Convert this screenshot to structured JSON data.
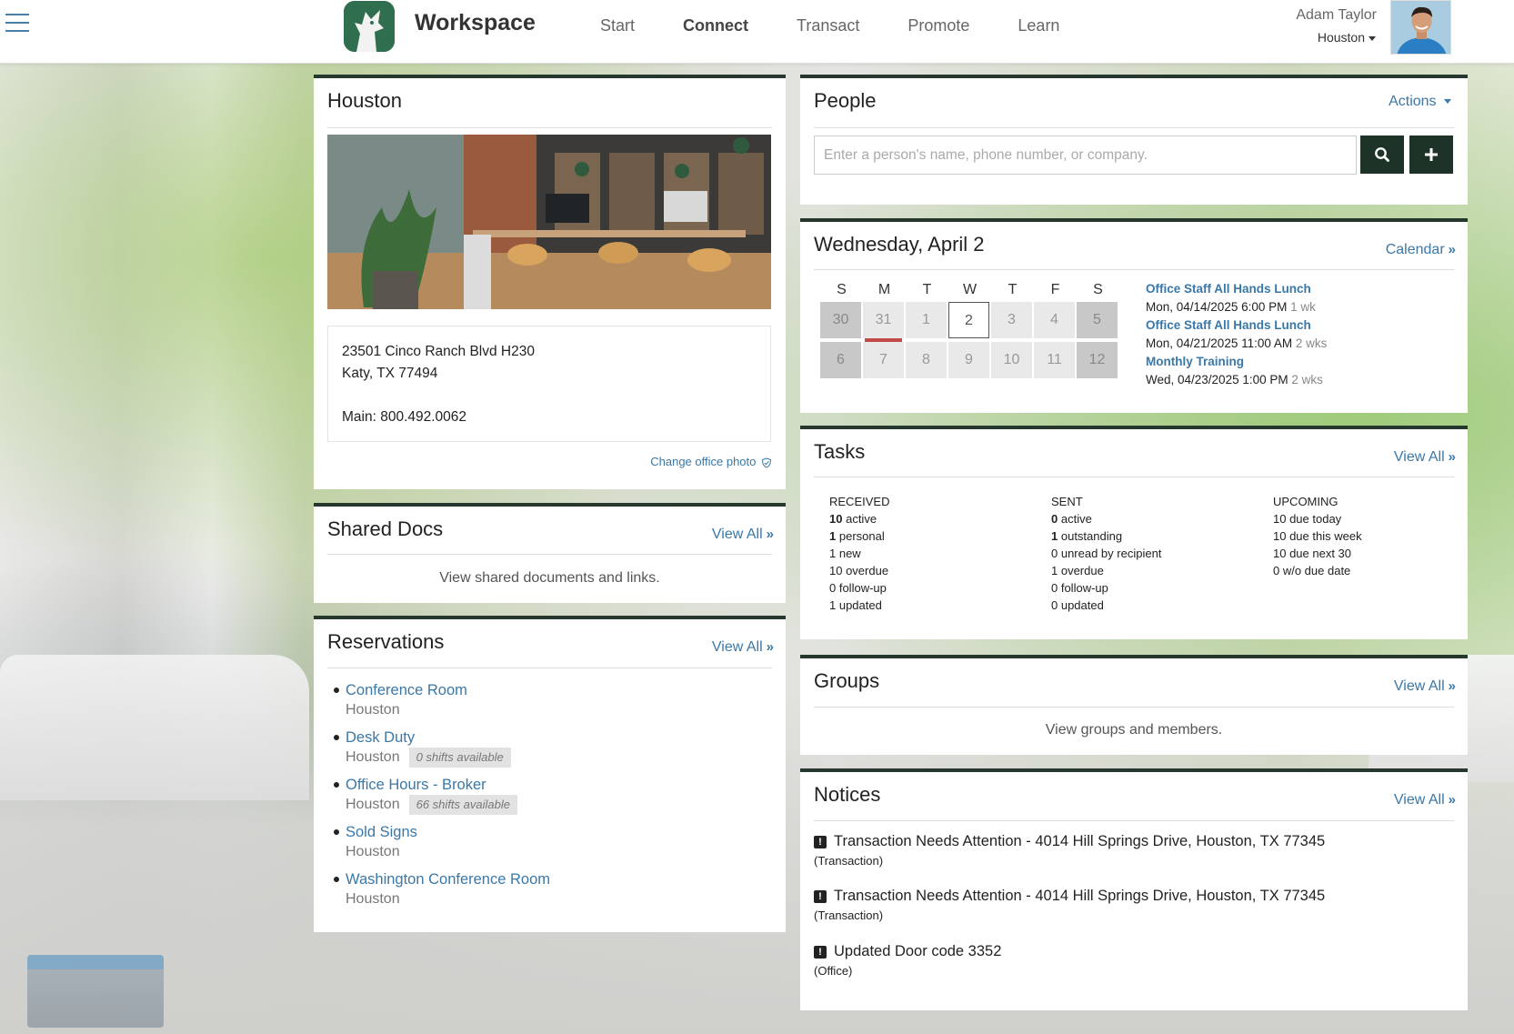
{
  "header": {
    "brand": "Workspace",
    "nav": [
      "Start",
      "Connect",
      "Transact",
      "Promote",
      "Learn"
    ],
    "active_nav": "Connect",
    "user_name": "Adam Taylor",
    "user_location": "Houston"
  },
  "office": {
    "title": "Houston",
    "address_line1": "23501 Cinco Ranch Blvd H230",
    "address_line2": "Katy, TX 77494",
    "main_phone": "Main: 800.492.0062",
    "change_photo": "Change office photo"
  },
  "shared_docs": {
    "title": "Shared Docs",
    "view_all": "View All",
    "text": "View shared documents and links."
  },
  "reservations": {
    "title": "Reservations",
    "view_all": "View All",
    "items": [
      {
        "name": "Conference Room",
        "location": "Houston",
        "badge": ""
      },
      {
        "name": "Desk Duty",
        "location": "Houston",
        "badge": "0 shifts available"
      },
      {
        "name": "Office Hours - Broker",
        "location": "Houston",
        "badge": "66 shifts available"
      },
      {
        "name": "Sold Signs",
        "location": "Houston",
        "badge": ""
      },
      {
        "name": "Washington Conference Room",
        "location": "Houston",
        "badge": ""
      }
    ]
  },
  "people": {
    "title": "People",
    "actions": "Actions",
    "search_placeholder": "Enter a person's name, phone number, or company.",
    "search_value": ""
  },
  "calendar": {
    "date_title": "Wednesday, April 2",
    "calendar_link": "Calendar",
    "weekdays": [
      "S",
      "M",
      "T",
      "W",
      "T",
      "F",
      "S"
    ],
    "week1": [
      "30",
      "31",
      "1",
      "2",
      "3",
      "4",
      "5"
    ],
    "week2": [
      "6",
      "7",
      "8",
      "9",
      "10",
      "11",
      "12"
    ],
    "today": "2",
    "events": [
      {
        "title": "Office Staff All Hands Lunch",
        "when": "Mon, 04/14/2025 6:00 PM",
        "rel": "1 wk"
      },
      {
        "title": "Office Staff All Hands Lunch",
        "when": "Mon, 04/21/2025 11:00 AM",
        "rel": "2 wks"
      },
      {
        "title": "Monthly Training",
        "when": "Wed, 04/23/2025 1:00 PM",
        "rel": "2 wks"
      }
    ]
  },
  "tasks": {
    "title": "Tasks",
    "view_all": "View All",
    "received": {
      "header": "RECEIVED",
      "active_count": "10",
      "active_label": "active",
      "personal_count": "1",
      "personal_label": "personal",
      "line3": "1 new",
      "line4": "10 overdue",
      "line5": "0 follow-up",
      "line6": "1 updated"
    },
    "sent": {
      "header": "SENT",
      "active_count": "0",
      "active_label": "active",
      "outstanding_count": "1",
      "outstanding_label": "outstanding",
      "line3": "0 unread by recipient",
      "line4": "1 overdue",
      "line5": "0 follow-up",
      "line6": "0 updated"
    },
    "upcoming": {
      "header": "UPCOMING",
      "line1": "10 due today",
      "line2": "10 due this week",
      "line3": "10 due next 30",
      "line4": "0 w/o due date"
    }
  },
  "groups": {
    "title": "Groups",
    "view_all": "View All",
    "text": "View groups and members."
  },
  "notices": {
    "title": "Notices",
    "view_all": "View All",
    "items": [
      {
        "text": "Transaction Needs Attention - 4014 Hill Springs Drive, Houston, TX 77345",
        "category": "(Transaction)"
      },
      {
        "text": "Transaction Needs Attention - 4014 Hill Springs Drive, Houston, TX 77345",
        "category": "(Transaction)"
      },
      {
        "text": "Updated Door code 3352",
        "category": "(Office)"
      }
    ]
  },
  "icons": [
    "hamburger-icon",
    "wolf-logo-icon",
    "caret-down-icon",
    "search-icon",
    "plus-icon",
    "double-chevron-right-icon",
    "shield-check-icon",
    "exclamation-icon"
  ],
  "colors": {
    "accent_link": "#3a78a8",
    "panel_border": "#26382e",
    "button_dark": "#1e3328",
    "brand_green": "#2f6f4f"
  }
}
